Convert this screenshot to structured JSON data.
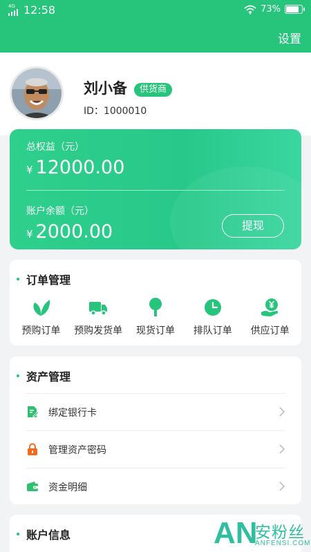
{
  "status_bar": {
    "network": "4G",
    "time": "12:58",
    "battery": "73%",
    "battery_level": 0.73
  },
  "header": {
    "settings_label": "设置"
  },
  "profile": {
    "name": "刘小备",
    "role": "供货商",
    "id_text": "ID：1000010"
  },
  "wallet": {
    "total_label": "总权益（元）",
    "total_currency": "¥",
    "total_value": "12000.00",
    "balance_label": "账户余额（元）",
    "balance_currency": "¥",
    "balance_value": "2000.00",
    "withdraw_label": "提现"
  },
  "orders": {
    "title": "订单管理",
    "items": [
      {
        "label": "预购订单",
        "icon": "leaf-icon"
      },
      {
        "label": "预购发货单",
        "icon": "truck-icon"
      },
      {
        "label": "现货订单",
        "icon": "tree-icon"
      },
      {
        "label": "排队订单",
        "icon": "clock-icon"
      },
      {
        "label": "供应订单",
        "icon": "yen-hand-icon"
      }
    ]
  },
  "assets": {
    "title": "资产管理",
    "items": [
      {
        "label": "绑定银行卡",
        "icon": "document-edit-icon"
      },
      {
        "label": "管理资产密码",
        "icon": "lock-icon"
      },
      {
        "label": "资金明细",
        "icon": "wallet-icon"
      }
    ]
  },
  "account": {
    "title": "账户信息"
  },
  "watermark": {
    "logo": "AN",
    "brand_cn": "安粉丝",
    "brand_en": "ANFENSI.COM"
  },
  "colors": {
    "primary": "#27c47c",
    "asset_icon_green": "#2fbf71",
    "lock_orange": "#f36b1c"
  }
}
